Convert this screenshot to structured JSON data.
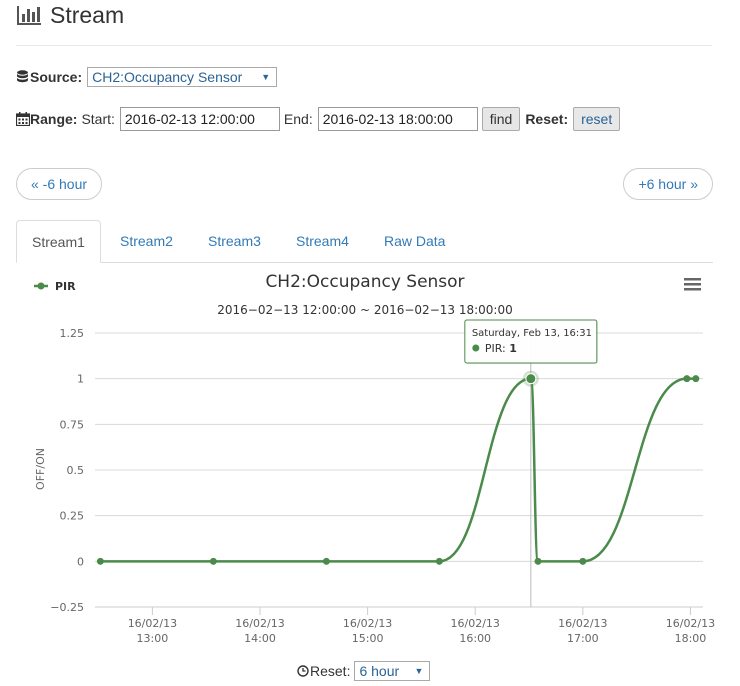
{
  "header": {
    "title": "Stream"
  },
  "source": {
    "label": "Source:",
    "value": "CH2:Occupancy Sensor"
  },
  "range": {
    "label": "Range:",
    "start_label": "Start:",
    "start_value": "2016-02-13 12:00:00",
    "end_label": "End:",
    "end_value": "2016-02-13 18:00:00",
    "find_label": "find",
    "reset_label": "Reset:",
    "reset_button": "reset"
  },
  "nav": {
    "prev": "« -6 hour",
    "next": "+6 hour »"
  },
  "tabs": [
    {
      "label": "Stream1",
      "active": true
    },
    {
      "label": "Stream2",
      "active": false
    },
    {
      "label": "Stream3",
      "active": false
    },
    {
      "label": "Stream4",
      "active": false
    },
    {
      "label": "Raw Data",
      "active": false
    }
  ],
  "footer": {
    "reset_label": "Reset:",
    "reset_value": "6 hour"
  },
  "colors": {
    "series": "#4a8a4a",
    "link": "#337ab7"
  },
  "tooltip": {
    "date": "Saturday, Feb 13, 16:31",
    "series": "PIR",
    "value": "1"
  },
  "chart_data": {
    "type": "line",
    "title": "CH2:Occupancy Sensor",
    "subtitle": "2016−02−13 12:00:00 ~ 2016−02−13 18:00:00",
    "ylabel": "OFF/ON",
    "xlabel": "",
    "ylim": [
      -0.25,
      1.25
    ],
    "yticks": [
      {
        "value": -0.25,
        "label": "−0.25"
      },
      {
        "value": 0,
        "label": "0"
      },
      {
        "value": 0.25,
        "label": "0.25"
      },
      {
        "value": 0.5,
        "label": "0.5"
      },
      {
        "value": 0.75,
        "label": "0.75"
      },
      {
        "value": 1,
        "label": "1"
      },
      {
        "value": 1.25,
        "label": "1.25"
      }
    ],
    "xlim": [
      "2016-02-13 12:28",
      "2016-02-13 18:07"
    ],
    "xticks": [
      {
        "t": "2016-02-13 13:00",
        "line1": "16/02/13",
        "line2": "13:00"
      },
      {
        "t": "2016-02-13 14:00",
        "line1": "16/02/13",
        "line2": "14:00"
      },
      {
        "t": "2016-02-13 15:00",
        "line1": "16/02/13",
        "line2": "15:00"
      },
      {
        "t": "2016-02-13 16:00",
        "line1": "16/02/13",
        "line2": "16:00"
      },
      {
        "t": "2016-02-13 17:00",
        "line1": "16/02/13",
        "line2": "17:00"
      },
      {
        "t": "2016-02-13 18:00",
        "line1": "16/02/13",
        "line2": "18:00"
      }
    ],
    "legend": "top-left",
    "grid": true,
    "series": [
      {
        "name": "PIR",
        "points": [
          {
            "x": "2016-02-13 12:31",
            "y": 0
          },
          {
            "x": "2016-02-13 13:34",
            "y": 0
          },
          {
            "x": "2016-02-13 14:37",
            "y": 0
          },
          {
            "x": "2016-02-13 15:40",
            "y": 0
          },
          {
            "x": "2016-02-13 16:31",
            "y": 1
          },
          {
            "x": "2016-02-13 16:35",
            "y": 0
          },
          {
            "x": "2016-02-13 17:00",
            "y": 0
          },
          {
            "x": "2016-02-13 17:58",
            "y": 1
          },
          {
            "x": "2016-02-13 18:03",
            "y": 1
          }
        ]
      }
    ]
  }
}
